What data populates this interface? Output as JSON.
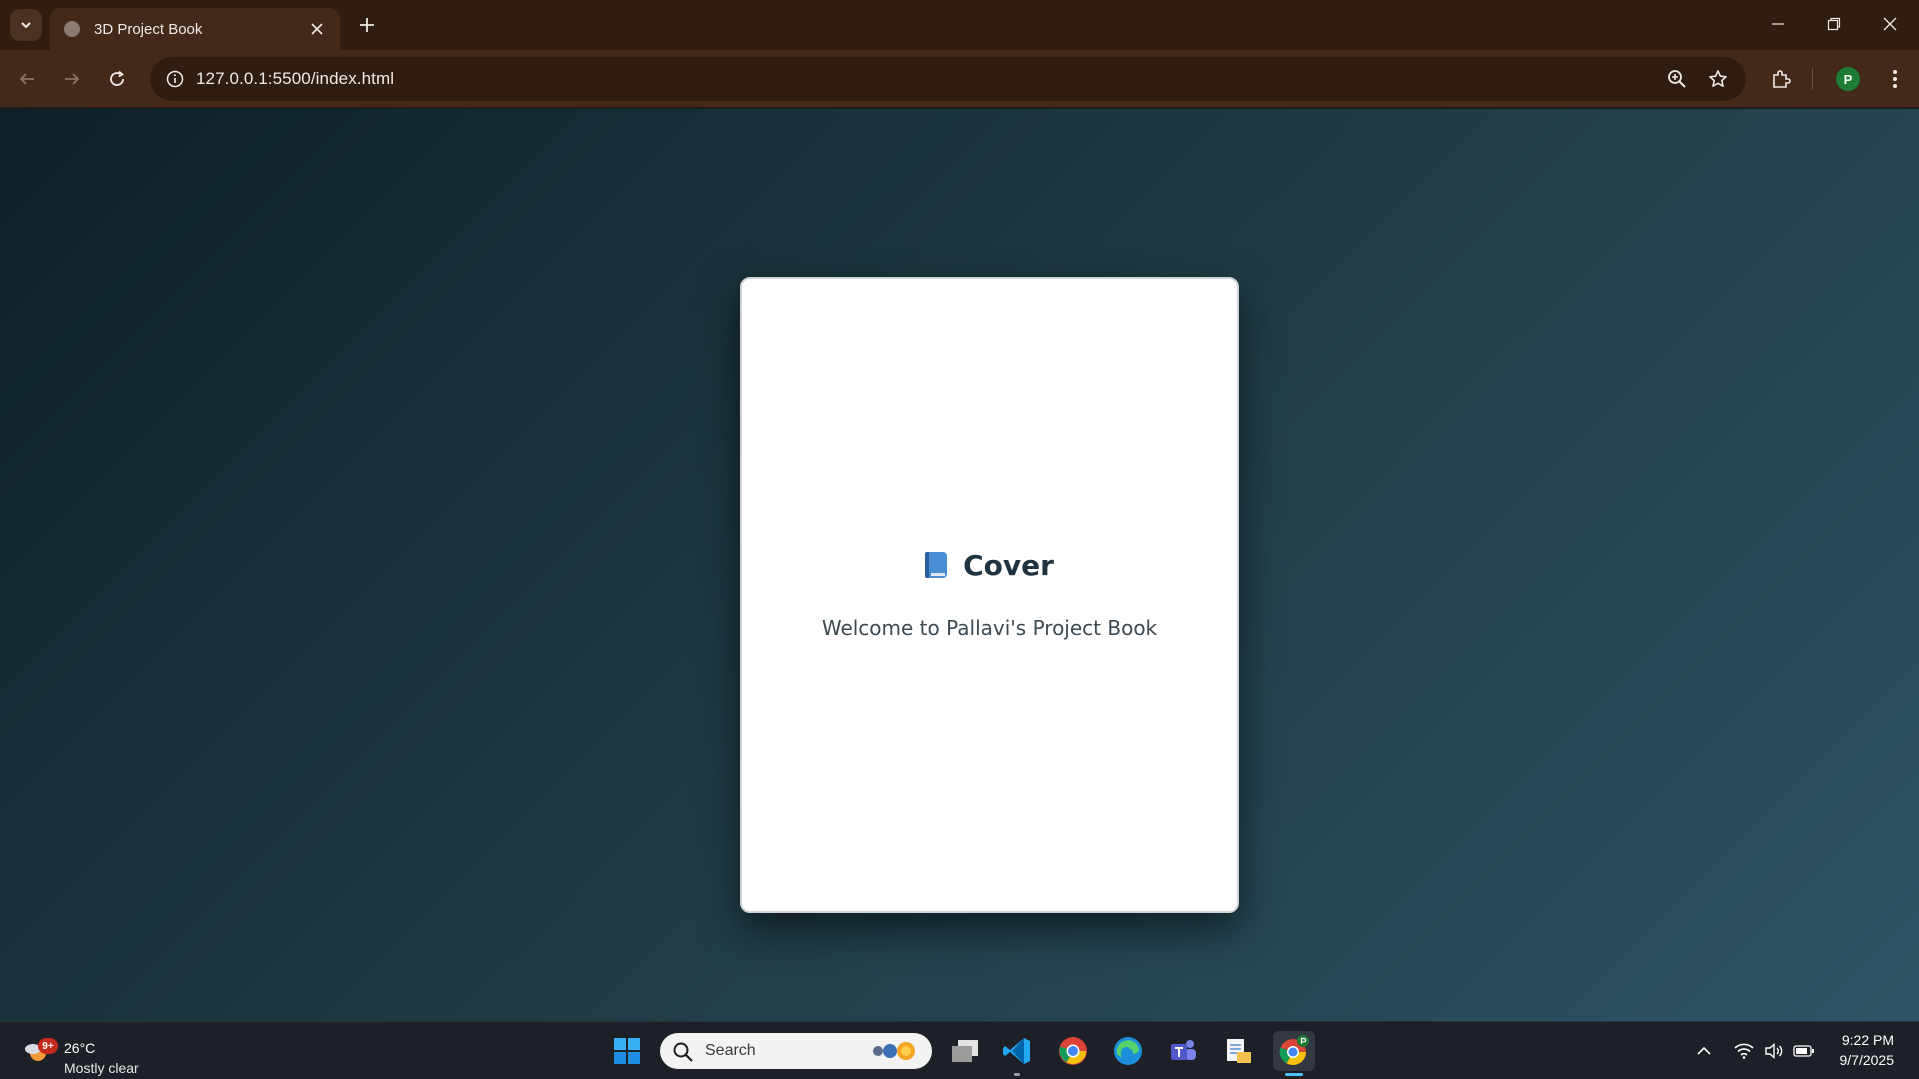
{
  "browser": {
    "tab_title": "3D Project Book",
    "url": "127.0.0.1:5500/index.html",
    "profile_initial": "P"
  },
  "page": {
    "cover_title": "Cover",
    "cover_icon": "blue-book-icon",
    "cover_subtitle": "Welcome to Pallavi's Project Book",
    "background_colors": [
      "#0f2027",
      "#203a43",
      "#2c5364"
    ]
  },
  "taskbar": {
    "weather_badge": "9+",
    "weather_temp": "26°C",
    "weather_desc": "Mostly clear",
    "search_label": "Search",
    "apps": [
      "start-button",
      "task-view",
      "vscode",
      "chrome",
      "edge",
      "teams",
      "file-explorer-pdf",
      "chrome-profile"
    ],
    "clock_time": "9:22 PM",
    "clock_date": "9/7/2025",
    "active_indicator_color": "#4cc2ff"
  }
}
